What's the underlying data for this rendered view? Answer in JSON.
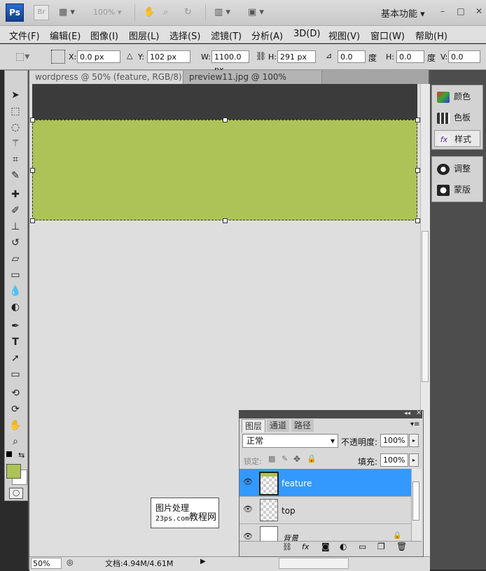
{
  "titlebar": {
    "app_logo": "Ps",
    "bridge_logo": "Br",
    "zoom_level": "100%",
    "workspace": "基本功能"
  },
  "menu": [
    "文件(F)",
    "编辑(E)",
    "图像(I)",
    "图层(L)",
    "选择(S)",
    "滤镜(T)",
    "分析(A)",
    "3D(D)",
    "视图(V)",
    "窗口(W)",
    "帮助(H)"
  ],
  "options": {
    "x_label": "X:",
    "x_value": "0.0 px",
    "y_label": "Y:",
    "y_value": "102 px",
    "w_label": "W:",
    "w_value": "1100.0 px",
    "h_label": "H:",
    "h_value": "291 px",
    "angle_value": "0.0",
    "angle_unit": "度",
    "skew_h_label": "H:",
    "skew_h_value": "0.0",
    "skew_unit": "度",
    "skew_v_label": "V:",
    "skew_v_value": "0.0"
  },
  "tabs": [
    {
      "label": "wordpress @ 50% (feature, RGB/8) *",
      "close": "×"
    },
    {
      "label": "preview11.jpg @ 100%(RGB/8#)",
      "close": "×"
    }
  ],
  "status": {
    "zoom": "50%",
    "doc_info": "文档:4.94M/4.61M"
  },
  "dock": {
    "color": "颜色",
    "swatches": "色板",
    "styles": "样式",
    "adjust": "调整",
    "masks": "蒙版"
  },
  "layers_panel": {
    "tabs": [
      "图层",
      "通道",
      "路径"
    ],
    "blend_mode": "正常",
    "opacity_label": "不透明度:",
    "opacity_value": "100%",
    "lock_label": "锁定:",
    "fill_label": "填充:",
    "fill_value": "100%",
    "layers": [
      {
        "name": "feature",
        "selected": true
      },
      {
        "name": "top",
        "selected": false
      },
      {
        "name": "背景",
        "selected": false
      }
    ]
  },
  "watermark": {
    "line1": "图片处理",
    "line2": "23ps.com",
    "line3": "教程网"
  },
  "colors": {
    "foreground": "#adc357",
    "layer_selected": "#3399ff"
  }
}
